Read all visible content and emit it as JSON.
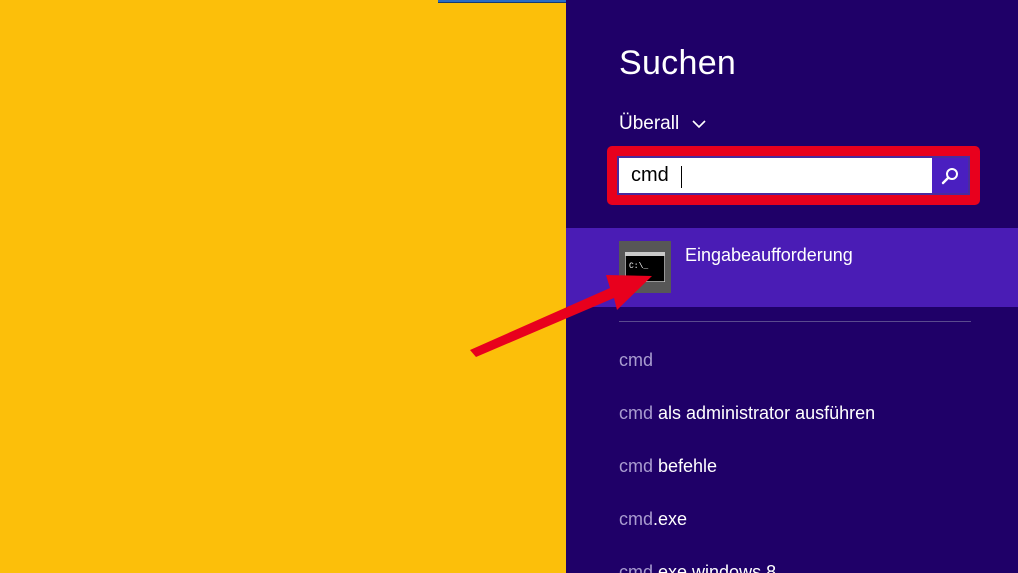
{
  "panel": {
    "title": "Suchen",
    "scope_label": "Überall",
    "search": {
      "value": "cmd"
    },
    "top_result": {
      "name": "Eingabeaufforderung",
      "icon_text": "C:\\_"
    },
    "suggestions": [
      {
        "query": "cmd",
        "rest": ""
      },
      {
        "query": "cmd",
        "rest": " als administrator ausführen"
      },
      {
        "query": "cmd",
        "rest": " befehle"
      },
      {
        "query": "cmd",
        "rest": ".exe"
      },
      {
        "query": "cmd",
        "rest": ".exe windows 8"
      }
    ]
  },
  "colors": {
    "desktop": "#fcbf0a",
    "panel": "#1f0068",
    "highlight": "#4a1cb5",
    "annotation_red": "#e8001d"
  },
  "icons": {
    "scope": "chevron-down-icon",
    "search": "search-icon",
    "app": "command-prompt-icon",
    "annotation": "red-arrow-annotation"
  }
}
